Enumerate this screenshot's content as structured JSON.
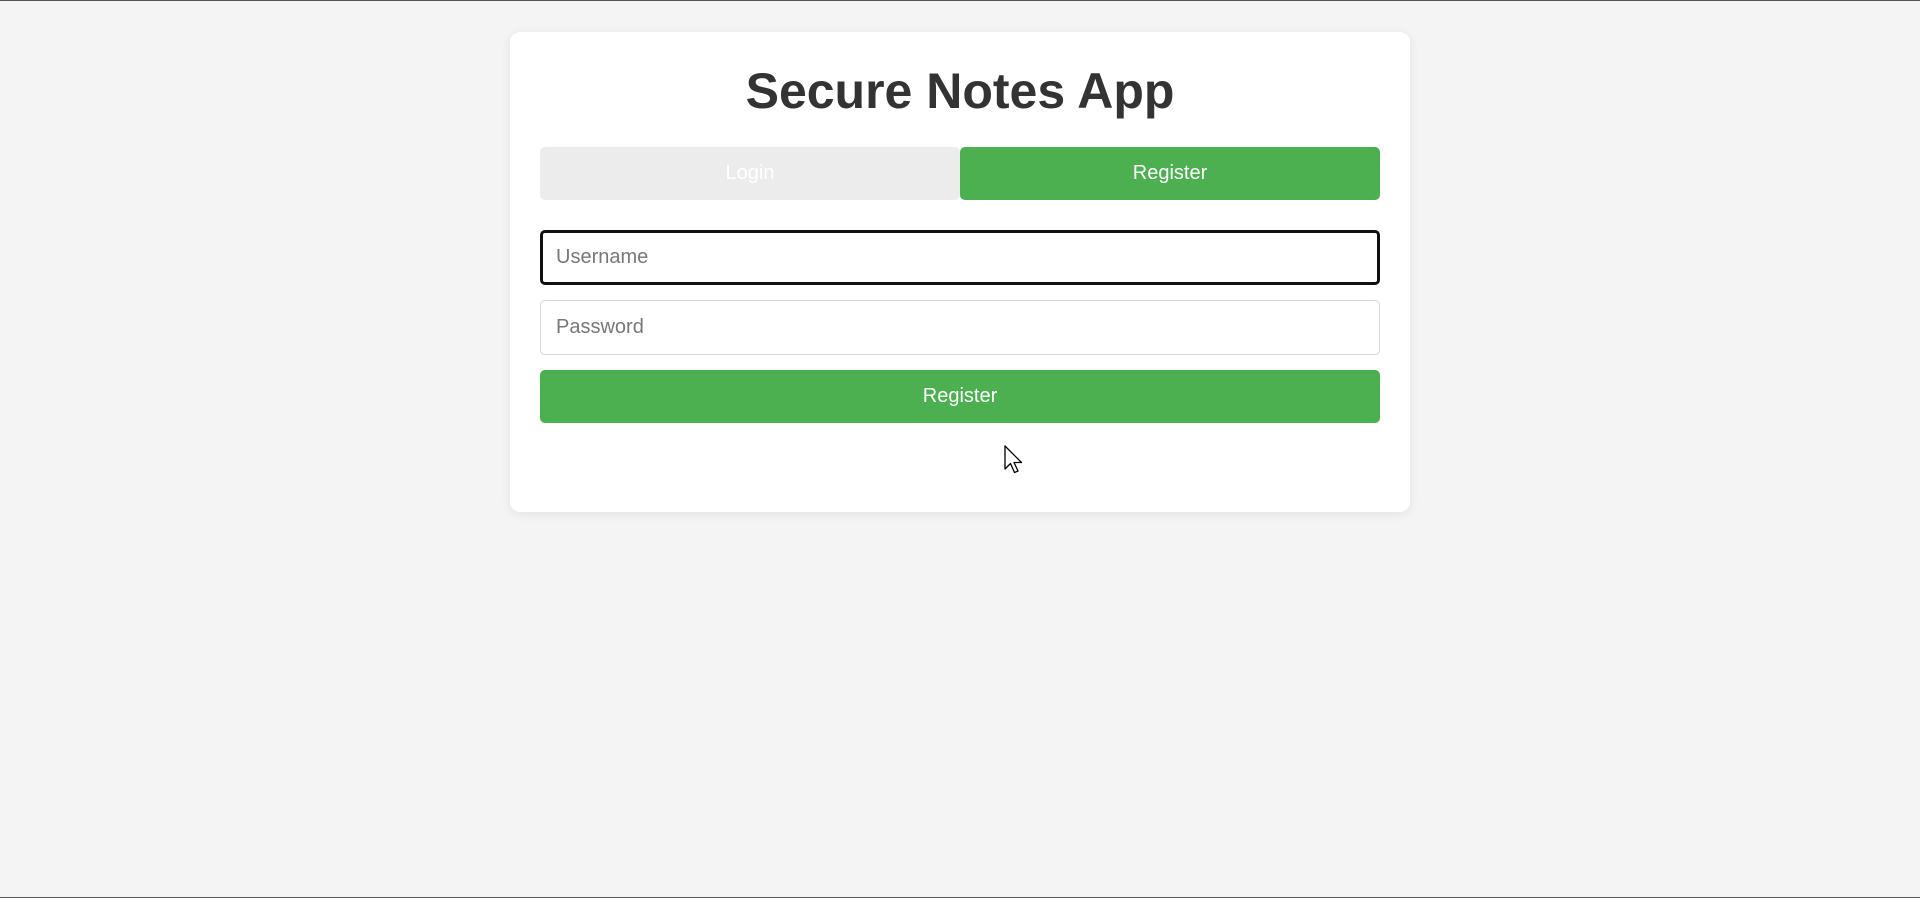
{
  "app": {
    "title": "Secure Notes App"
  },
  "tabs": [
    {
      "label": "Login",
      "active": false
    },
    {
      "label": "Register",
      "active": true
    }
  ],
  "form": {
    "username": {
      "placeholder": "Username",
      "value": ""
    },
    "password": {
      "placeholder": "Password",
      "value": ""
    },
    "submit_label": "Register"
  },
  "colors": {
    "accent": "#4caf50",
    "inactive_tab": "#ececec",
    "background": "#f4f4f4",
    "title": "#333333"
  },
  "icons": {
    "cursor": "mouse-pointer-icon"
  }
}
